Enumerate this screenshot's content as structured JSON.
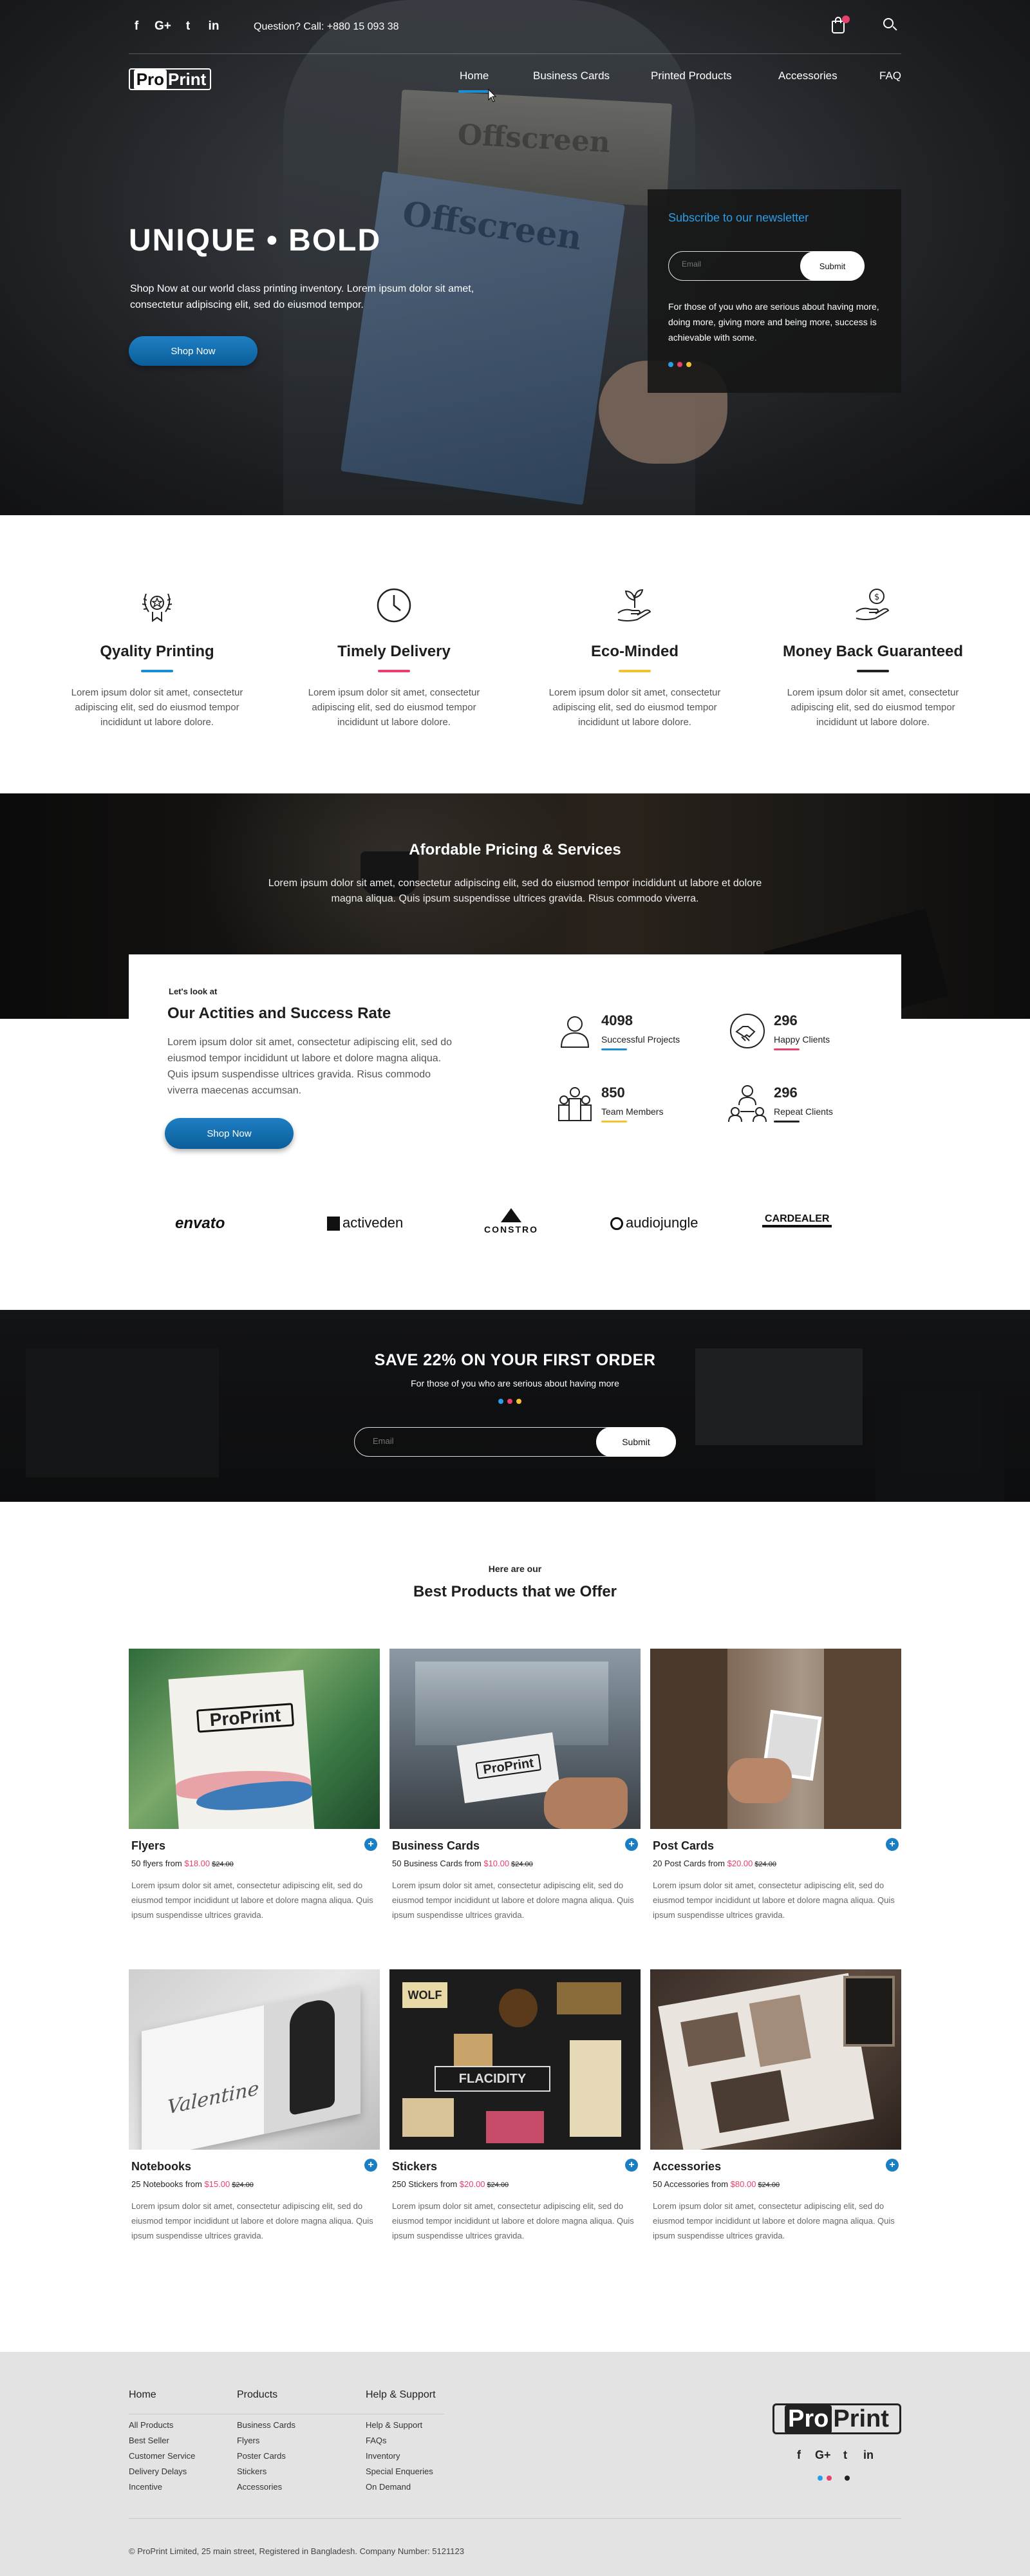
{
  "header": {
    "social": [
      "f",
      "G+",
      "t",
      "in"
    ],
    "phone": "Question? Call: +880 15 093 38",
    "logo": {
      "pro": "Pro",
      "print": "Print"
    },
    "nav": [
      "Home",
      "Business Cards",
      "Printed Products",
      "Accessories",
      "FAQ"
    ],
    "active_nav": "Home"
  },
  "hero": {
    "title": "UNIQUE  •  BOLD",
    "text": "Shop Now at our world class printing inventory. Lorem ipsum dolor sit amet, consectetur adipiscing elit, sed do eiusmod tempor.",
    "button": "Shop Now",
    "magazine_text": "Offscreen"
  },
  "newsletter": {
    "heading": "Subscribe to our newsletter",
    "placeholder": "Email",
    "submit": "Submit",
    "text": "For those of you who are serious about having more, doing more, giving more and being more, success is achievable with some.",
    "dot_colors": [
      "#2a9de6",
      "#e8416d",
      "#f2c230"
    ]
  },
  "features": [
    {
      "icon": "award-icon",
      "title": "Qyality Printing",
      "line_color": "#1b8ed3",
      "text": "Lorem ipsum dolor sit amet, consectetur adipiscing elit, sed do eiusmod tempor incididunt ut labore dolore."
    },
    {
      "icon": "clock-icon",
      "title": "Timely Delivery",
      "line_color": "#e8416d",
      "text": "Lorem ipsum dolor sit amet, consectetur adipiscing elit, sed do eiusmod tempor incididunt ut labore dolore."
    },
    {
      "icon": "plant-hand-icon",
      "title": "Eco-Minded",
      "line_color": "#f2c230",
      "text": "Lorem ipsum dolor sit amet, consectetur adipiscing elit, sed do eiusmod tempor incididunt ut labore dolore."
    },
    {
      "icon": "money-hand-icon",
      "title": "Money Back Guaranteed",
      "line_color": "#222222",
      "text": "Lorem ipsum dolor sit amet, consectetur adipiscing elit, sed do eiusmod tempor incididunt ut labore dolore."
    }
  ],
  "pricing": {
    "title": "Afordable Pricing & Services",
    "text": "Lorem ipsum dolor sit amet, consectetur adipiscing elit, sed do eiusmod tempor incididunt ut labore et dolore magna aliqua. Quis ipsum suspendisse ultrices gravida. Risus commodo viverra."
  },
  "stats": {
    "eyebrow": "Let's look at",
    "title": "Our Actities and Success Rate",
    "text": "Lorem ipsum dolor sit amet, consectetur adipiscing elit, sed do eiusmod tempor incididunt ut labore et dolore magna aliqua. Quis ipsum suspendisse ultrices gravida. Risus commodo viverra maecenas accumsan.",
    "button": "Shop Now",
    "items": [
      {
        "icon": "user-icon",
        "value": "4098",
        "label": "Successful Projects",
        "line_color": "#1b8ed3"
      },
      {
        "icon": "handshake-icon",
        "value": "296",
        "label": "Happy Clients",
        "line_color": "#e8416d"
      },
      {
        "icon": "team-icon",
        "value": "850",
        "label": "Team Members",
        "line_color": "#f2c230"
      },
      {
        "icon": "clients-icon",
        "value": "296",
        "label": "Repeat Clients",
        "line_color": "#222222"
      }
    ]
  },
  "brands": [
    "envato",
    "activeden",
    "CONSTRO",
    "audiojungle",
    "CARDEALER"
  ],
  "save": {
    "title": "SAVE 22% ON YOUR FIRST ORDER",
    "text": "For those of you who are serious about having more",
    "placeholder": "Email",
    "submit": "Submit",
    "dot_colors": [
      "#2a9de6",
      "#e8416d",
      "#f2c230"
    ]
  },
  "products": {
    "eyebrow": "Here are our",
    "title": "Best Products that we Offer",
    "items": [
      {
        "name": "Flyers",
        "prefix": "50 flyers from ",
        "price": "$18.00",
        "old": "$24.00",
        "desc": "Lorem ipsum dolor sit amet, consectetur adipiscing elit, sed do eiusmod tempor incididunt ut labore et dolore magna aliqua. Quis ipsum suspendisse ultrices gravida."
      },
      {
        "name": "Business Cards",
        "prefix": "50 Business Cards from ",
        "price": "$10.00",
        "old": "$24.00",
        "desc": "Lorem ipsum dolor sit amet, consectetur adipiscing elit, sed do eiusmod tempor incididunt ut labore et dolore magna aliqua. Quis ipsum suspendisse ultrices gravida."
      },
      {
        "name": "Post Cards",
        "prefix": "20 Post Cards from ",
        "price": "$20.00",
        "old": "$24.00",
        "desc": "Lorem ipsum dolor sit amet, consectetur adipiscing elit, sed do eiusmod tempor incididunt ut labore et dolore magna aliqua. Quis ipsum suspendisse ultrices gravida."
      },
      {
        "name": "Notebooks",
        "prefix": "25 Notebooks from ",
        "price": "$15.00",
        "old": "$24.00",
        "desc": "Lorem ipsum dolor sit amet, consectetur adipiscing elit, sed do eiusmod tempor incididunt ut labore et dolore magna aliqua. Quis ipsum suspendisse ultrices gravida."
      },
      {
        "name": "Stickers",
        "prefix": "250 Stickers from ",
        "price": "$20.00",
        "old": "$24.00",
        "desc": "Lorem ipsum dolor sit amet, consectetur adipiscing elit, sed do eiusmod tempor incididunt ut labore et dolore magna aliqua. Quis ipsum suspendisse ultrices gravida."
      },
      {
        "name": "Accessories",
        "prefix": "50 Accessories from ",
        "price": "$80.00",
        "old": "$24.00",
        "desc": "Lorem ipsum dolor sit amet, consectetur adipiscing elit, sed do eiusmod tempor incididunt ut labore et dolore magna aliqua. Quis ipsum suspendisse ultrices gravida."
      }
    ],
    "image_texts": {
      "flyer_logo": "ProPrint",
      "card_logo": "ProPrint",
      "notebook_text": "Valentine",
      "sticker_text": "FLACIDITY",
      "sticker_wolf": "WOLF"
    }
  },
  "footer": {
    "columns": [
      {
        "title": "Home",
        "items": [
          "All Products",
          "Best Seller",
          "Customer Service",
          "Delivery Delays",
          "Incentive"
        ]
      },
      {
        "title": "Products",
        "items": [
          "Business Cards",
          "Flyers",
          "Poster Cards",
          "Stickers",
          "Accessories"
        ]
      },
      {
        "title": "Help & Support",
        "items": [
          "Help & Support",
          "FAQs",
          "Inventory",
          "Special Enqueries",
          "On Demand"
        ]
      }
    ],
    "logo": {
      "pro": "Pro",
      "print": "Print"
    },
    "social": [
      "f",
      "G+",
      "t",
      "in"
    ],
    "dot_colors": [
      "#2a9de6",
      "#e8416d",
      "#222222"
    ],
    "copyright": "© ProPrint Limited, 25 main street, Registered in Bangladesh. Company Number: 5121123"
  }
}
